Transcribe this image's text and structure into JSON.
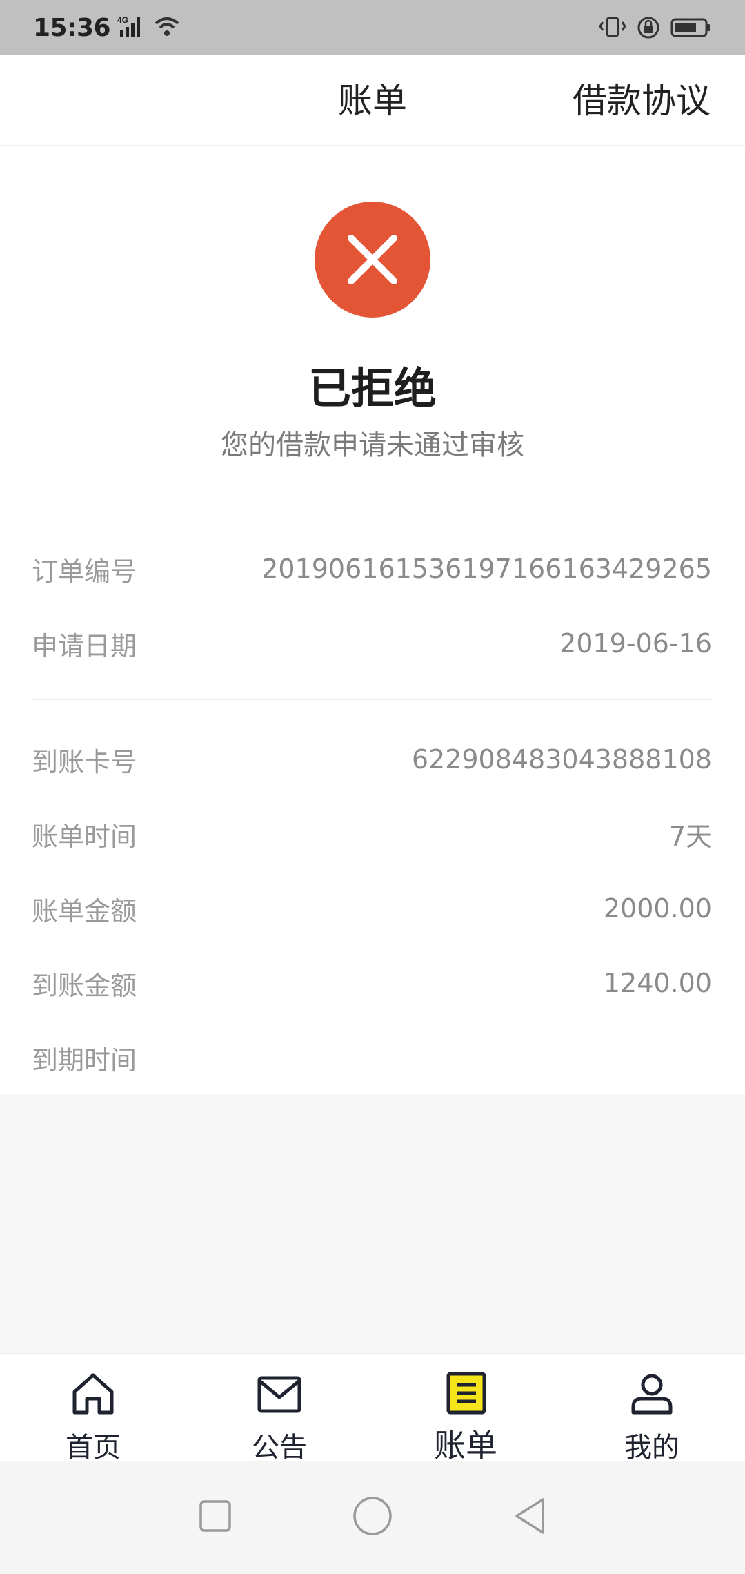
{
  "status_bar": {
    "time": "15:36",
    "network": "4G",
    "icons": [
      "signal-icon",
      "wifi-icon",
      "vibrate-icon",
      "rotation-lock-icon",
      "battery-icon"
    ]
  },
  "header": {
    "title": "账单",
    "action": "借款协议"
  },
  "result": {
    "icon": "close-icon",
    "icon_color": "#e35535",
    "title": "已拒绝",
    "subtitle": "您的借款申请未通过审核"
  },
  "details": {
    "order_no": {
      "label": "订单编号",
      "value": "20190616153619716616342926​5"
    },
    "apply_date": {
      "label": "申请日期",
      "value": "2019-06-16"
    },
    "card_no": {
      "label": "到账卡号",
      "value": "6229084830438881​08"
    },
    "bill_period": {
      "label": "账单时间",
      "value": "7天"
    },
    "bill_amount": {
      "label": "账单金额",
      "value": "2000.00"
    },
    "received_amount": {
      "label": "到账金额",
      "value": "1240.00"
    },
    "due_date": {
      "label": "到期时间",
      "value": ""
    }
  },
  "bottom_nav": {
    "items": [
      {
        "label": "首页",
        "icon": "home-icon",
        "active": false
      },
      {
        "label": "公告",
        "icon": "mail-icon",
        "active": false
      },
      {
        "label": "账单",
        "icon": "bill-icon",
        "active": true
      },
      {
        "label": "我的",
        "icon": "user-icon",
        "active": false
      }
    ],
    "active_highlight": "#f5e51a"
  },
  "system_nav": {
    "buttons": [
      "recent-apps-icon",
      "home-circle-icon",
      "back-icon"
    ]
  }
}
